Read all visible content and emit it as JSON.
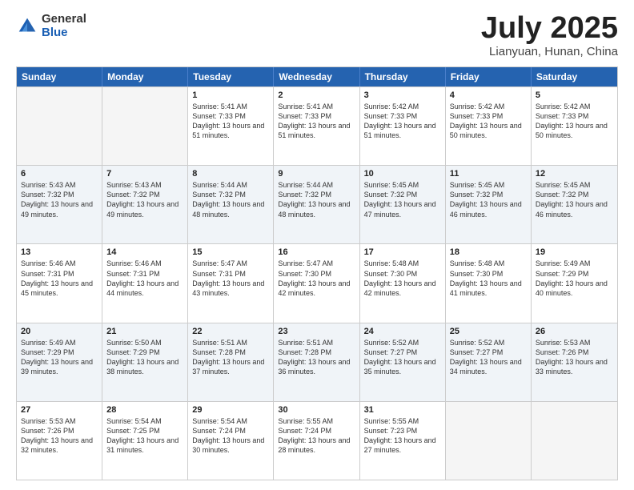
{
  "logo": {
    "general": "General",
    "blue": "Blue"
  },
  "header": {
    "month": "July 2025",
    "location": "Lianyuan, Hunan, China"
  },
  "weekdays": [
    "Sunday",
    "Monday",
    "Tuesday",
    "Wednesday",
    "Thursday",
    "Friday",
    "Saturday"
  ],
  "rows": [
    [
      {
        "date": "",
        "sunrise": "",
        "sunset": "",
        "daylight": "",
        "empty": true
      },
      {
        "date": "",
        "sunrise": "",
        "sunset": "",
        "daylight": "",
        "empty": true
      },
      {
        "date": "1",
        "sunrise": "Sunrise: 5:41 AM",
        "sunset": "Sunset: 7:33 PM",
        "daylight": "Daylight: 13 hours and 51 minutes.",
        "empty": false
      },
      {
        "date": "2",
        "sunrise": "Sunrise: 5:41 AM",
        "sunset": "Sunset: 7:33 PM",
        "daylight": "Daylight: 13 hours and 51 minutes.",
        "empty": false
      },
      {
        "date": "3",
        "sunrise": "Sunrise: 5:42 AM",
        "sunset": "Sunset: 7:33 PM",
        "daylight": "Daylight: 13 hours and 51 minutes.",
        "empty": false
      },
      {
        "date": "4",
        "sunrise": "Sunrise: 5:42 AM",
        "sunset": "Sunset: 7:33 PM",
        "daylight": "Daylight: 13 hours and 50 minutes.",
        "empty": false
      },
      {
        "date": "5",
        "sunrise": "Sunrise: 5:42 AM",
        "sunset": "Sunset: 7:33 PM",
        "daylight": "Daylight: 13 hours and 50 minutes.",
        "empty": false
      }
    ],
    [
      {
        "date": "6",
        "sunrise": "Sunrise: 5:43 AM",
        "sunset": "Sunset: 7:32 PM",
        "daylight": "Daylight: 13 hours and 49 minutes.",
        "empty": false
      },
      {
        "date": "7",
        "sunrise": "Sunrise: 5:43 AM",
        "sunset": "Sunset: 7:32 PM",
        "daylight": "Daylight: 13 hours and 49 minutes.",
        "empty": false
      },
      {
        "date": "8",
        "sunrise": "Sunrise: 5:44 AM",
        "sunset": "Sunset: 7:32 PM",
        "daylight": "Daylight: 13 hours and 48 minutes.",
        "empty": false
      },
      {
        "date": "9",
        "sunrise": "Sunrise: 5:44 AM",
        "sunset": "Sunset: 7:32 PM",
        "daylight": "Daylight: 13 hours and 48 minutes.",
        "empty": false
      },
      {
        "date": "10",
        "sunrise": "Sunrise: 5:45 AM",
        "sunset": "Sunset: 7:32 PM",
        "daylight": "Daylight: 13 hours and 47 minutes.",
        "empty": false
      },
      {
        "date": "11",
        "sunrise": "Sunrise: 5:45 AM",
        "sunset": "Sunset: 7:32 PM",
        "daylight": "Daylight: 13 hours and 46 minutes.",
        "empty": false
      },
      {
        "date": "12",
        "sunrise": "Sunrise: 5:45 AM",
        "sunset": "Sunset: 7:32 PM",
        "daylight": "Daylight: 13 hours and 46 minutes.",
        "empty": false
      }
    ],
    [
      {
        "date": "13",
        "sunrise": "Sunrise: 5:46 AM",
        "sunset": "Sunset: 7:31 PM",
        "daylight": "Daylight: 13 hours and 45 minutes.",
        "empty": false
      },
      {
        "date": "14",
        "sunrise": "Sunrise: 5:46 AM",
        "sunset": "Sunset: 7:31 PM",
        "daylight": "Daylight: 13 hours and 44 minutes.",
        "empty": false
      },
      {
        "date": "15",
        "sunrise": "Sunrise: 5:47 AM",
        "sunset": "Sunset: 7:31 PM",
        "daylight": "Daylight: 13 hours and 43 minutes.",
        "empty": false
      },
      {
        "date": "16",
        "sunrise": "Sunrise: 5:47 AM",
        "sunset": "Sunset: 7:30 PM",
        "daylight": "Daylight: 13 hours and 42 minutes.",
        "empty": false
      },
      {
        "date": "17",
        "sunrise": "Sunrise: 5:48 AM",
        "sunset": "Sunset: 7:30 PM",
        "daylight": "Daylight: 13 hours and 42 minutes.",
        "empty": false
      },
      {
        "date": "18",
        "sunrise": "Sunrise: 5:48 AM",
        "sunset": "Sunset: 7:30 PM",
        "daylight": "Daylight: 13 hours and 41 minutes.",
        "empty": false
      },
      {
        "date": "19",
        "sunrise": "Sunrise: 5:49 AM",
        "sunset": "Sunset: 7:29 PM",
        "daylight": "Daylight: 13 hours and 40 minutes.",
        "empty": false
      }
    ],
    [
      {
        "date": "20",
        "sunrise": "Sunrise: 5:49 AM",
        "sunset": "Sunset: 7:29 PM",
        "daylight": "Daylight: 13 hours and 39 minutes.",
        "empty": false
      },
      {
        "date": "21",
        "sunrise": "Sunrise: 5:50 AM",
        "sunset": "Sunset: 7:29 PM",
        "daylight": "Daylight: 13 hours and 38 minutes.",
        "empty": false
      },
      {
        "date": "22",
        "sunrise": "Sunrise: 5:51 AM",
        "sunset": "Sunset: 7:28 PM",
        "daylight": "Daylight: 13 hours and 37 minutes.",
        "empty": false
      },
      {
        "date": "23",
        "sunrise": "Sunrise: 5:51 AM",
        "sunset": "Sunset: 7:28 PM",
        "daylight": "Daylight: 13 hours and 36 minutes.",
        "empty": false
      },
      {
        "date": "24",
        "sunrise": "Sunrise: 5:52 AM",
        "sunset": "Sunset: 7:27 PM",
        "daylight": "Daylight: 13 hours and 35 minutes.",
        "empty": false
      },
      {
        "date": "25",
        "sunrise": "Sunrise: 5:52 AM",
        "sunset": "Sunset: 7:27 PM",
        "daylight": "Daylight: 13 hours and 34 minutes.",
        "empty": false
      },
      {
        "date": "26",
        "sunrise": "Sunrise: 5:53 AM",
        "sunset": "Sunset: 7:26 PM",
        "daylight": "Daylight: 13 hours and 33 minutes.",
        "empty": false
      }
    ],
    [
      {
        "date": "27",
        "sunrise": "Sunrise: 5:53 AM",
        "sunset": "Sunset: 7:26 PM",
        "daylight": "Daylight: 13 hours and 32 minutes.",
        "empty": false
      },
      {
        "date": "28",
        "sunrise": "Sunrise: 5:54 AM",
        "sunset": "Sunset: 7:25 PM",
        "daylight": "Daylight: 13 hours and 31 minutes.",
        "empty": false
      },
      {
        "date": "29",
        "sunrise": "Sunrise: 5:54 AM",
        "sunset": "Sunset: 7:24 PM",
        "daylight": "Daylight: 13 hours and 30 minutes.",
        "empty": false
      },
      {
        "date": "30",
        "sunrise": "Sunrise: 5:55 AM",
        "sunset": "Sunset: 7:24 PM",
        "daylight": "Daylight: 13 hours and 28 minutes.",
        "empty": false
      },
      {
        "date": "31",
        "sunrise": "Sunrise: 5:55 AM",
        "sunset": "Sunset: 7:23 PM",
        "daylight": "Daylight: 13 hours and 27 minutes.",
        "empty": false
      },
      {
        "date": "",
        "sunrise": "",
        "sunset": "",
        "daylight": "",
        "empty": true
      },
      {
        "date": "",
        "sunrise": "",
        "sunset": "",
        "daylight": "",
        "empty": true
      }
    ]
  ]
}
